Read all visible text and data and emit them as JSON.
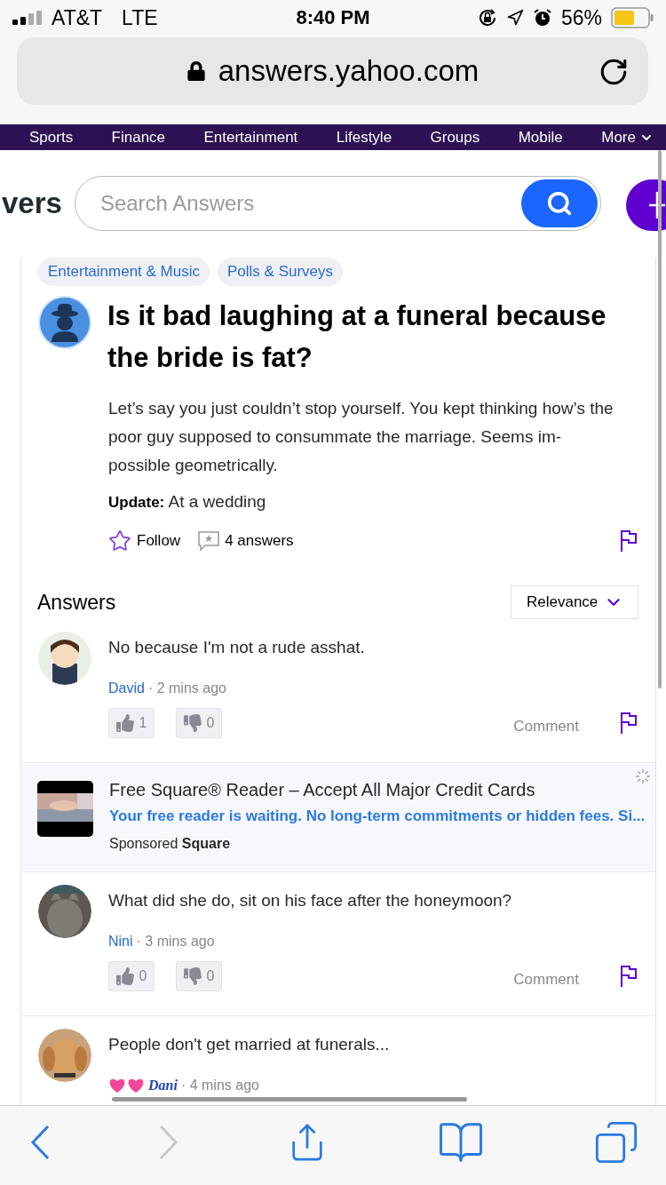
{
  "status_bar": {
    "carrier": "AT&T",
    "network": "LTE",
    "time": "8:40 PM",
    "battery": "56%"
  },
  "address_bar": {
    "url": "answers.yahoo.com"
  },
  "nav": [
    {
      "label": "Sports",
      "menu": false
    },
    {
      "label": "Finance",
      "menu": false
    },
    {
      "label": "Entertainment",
      "menu": false
    },
    {
      "label": "Lifestyle",
      "menu": false
    },
    {
      "label": "Groups",
      "menu": false
    },
    {
      "label": "Mobile",
      "menu": false
    },
    {
      "label": "More",
      "menu": true
    }
  ],
  "header": {
    "logo_fragment": "vers",
    "search": {
      "placeholder": "Search Answers"
    }
  },
  "question": {
    "tags": [
      "Entertainment & Music",
      "Polls & Surveys"
    ],
    "title": "Is it bad laughing at a funeral because the bride is fat?",
    "body": "Let’s say you just couldn’t stop yourself. You kept thinking how’s the poor guy supposed to consummate the marriage. Seems im-possible geometrically.",
    "update": "**Update:** At a wedding",
    "follow": "Follow",
    "answer_count": "4 answers"
  },
  "answers_header": {
    "title": "Answers",
    "sort": "Relevance"
  },
  "feed": [
    {
      "kind": "answer",
      "text": "No because I'm not a rude asshat.",
      "author": "David",
      "author_hearts": false,
      "time": "· 2 mins ago",
      "upvotes": "1",
      "downvotes": "0",
      "comment": "Comment"
    },
    {
      "kind": "ad",
      "title": "Free Square® Reader – Accept All Major Credit Cards",
      "description": "Your free reader is waiting. No long-term commitments or hidden fees. Si...",
      "sponsor": "Sponsored **Square**"
    },
    {
      "kind": "answer",
      "text": "What did she do, sit on his face after the honeymoon?",
      "author": "Nini",
      "author_hearts": false,
      "time": "· 3 mins ago",
      "upvotes": "0",
      "downvotes": "0",
      "comment": "Comment"
    },
    {
      "kind": "answer",
      "text": "People don't get married at funerals...",
      "author": "Dani",
      "author_hearts": true,
      "time": "· 4 mins ago"
    }
  ],
  "toolbar": [
    {
      "kind": "back",
      "disabled": false
    },
    {
      "kind": "forward",
      "disabled": true
    },
    {
      "kind": "share",
      "disabled": false
    },
    {
      "kind": "bookmarks",
      "disabled": false
    },
    {
      "kind": "tabs",
      "disabled": false
    }
  ]
}
